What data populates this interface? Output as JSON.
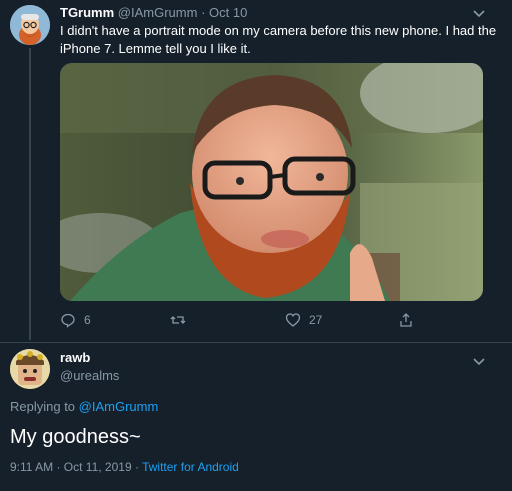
{
  "tweet": {
    "author_name": "TGrumm",
    "handle": "@IAmGrumm",
    "separator": "·",
    "date": "Oct 10",
    "text": "I didn't have a portrait mode on my camera before this new phone. I had the iPhone 7. Lemme tell you I like it.",
    "reply_count": "6",
    "retweet_count": "",
    "like_count": "27"
  },
  "reply": {
    "author_name": "rawb",
    "handle": "@urealms",
    "replying_prefix": "Replying to",
    "replying_to": "@IAmGrumm",
    "text": "My goodness~",
    "timestamp": "9:11 AM · Oct 11, 2019",
    "separator": "·",
    "source": "Twitter for Android"
  },
  "colors": {
    "background": "#15202b",
    "secondary_text": "#8899a6",
    "link": "#1da1f2",
    "divider": "#38444d"
  },
  "icons": {
    "reply": "reply-icon",
    "retweet": "retweet-icon",
    "like": "heart-icon",
    "share": "share-icon",
    "more": "chevron-down-icon"
  }
}
